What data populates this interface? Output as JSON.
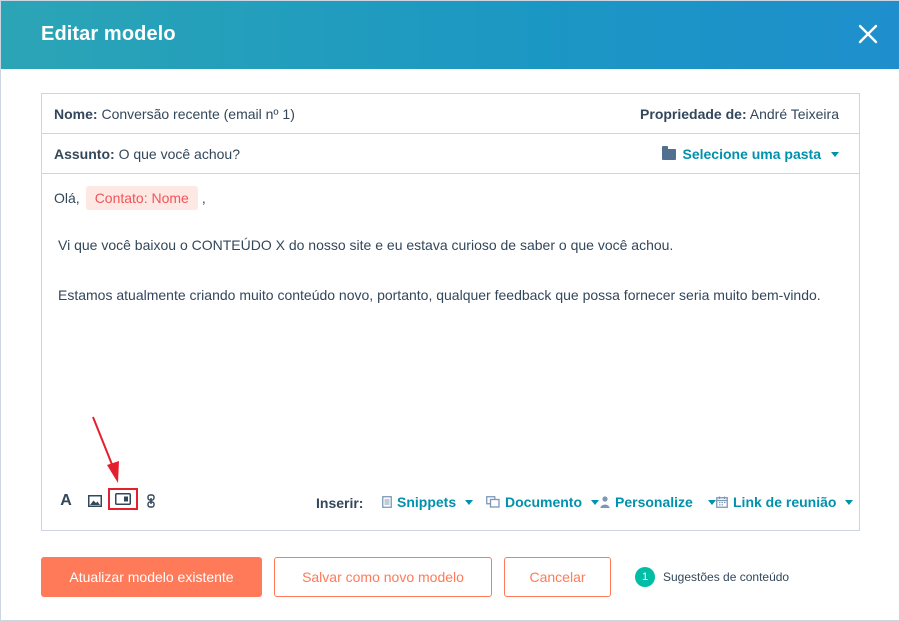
{
  "header": {
    "title": "Editar modelo"
  },
  "fields": {
    "name_label": "Nome:",
    "name_value": "Conversão recente (email nº 1)",
    "owner_label": "Propriedade de:",
    "owner_value": "André Teixeira",
    "subject_label": "Assunto:",
    "subject_value": "O que você achou?",
    "folder_select": "Selecione uma pasta"
  },
  "body": {
    "greeting": "Olá,",
    "token": "Contato: Nome",
    "comma": ",",
    "paragraph1": "Vi que você baixou o CONTEÚDO X do nosso site e eu estava curioso de saber o que você achou.",
    "paragraph2": "Estamos atualmente criando muito conteúdo novo, portanto, qualquer feedback que possa fornecer seria muito bem-vindo."
  },
  "toolbar": {
    "text_format_glyph": "A",
    "insert_label": "Inserir:",
    "snippets": "Snippets",
    "document": "Documento",
    "personalize": "Personalize",
    "meeting_link": "Link de reunião"
  },
  "footer": {
    "update_button": "Atualizar modelo existente",
    "save_new_button": "Salvar como novo modelo",
    "cancel_button": "Cancelar",
    "suggestions_count": "1",
    "suggestions_label": "Sugestões de conteúdo"
  },
  "colors": {
    "accent": "#ff7a59",
    "link": "#0091ae",
    "header_start": "#2ba5b5",
    "header_end": "#1e8fcc",
    "highlight": "#e5202e",
    "badge": "#00bda5"
  }
}
